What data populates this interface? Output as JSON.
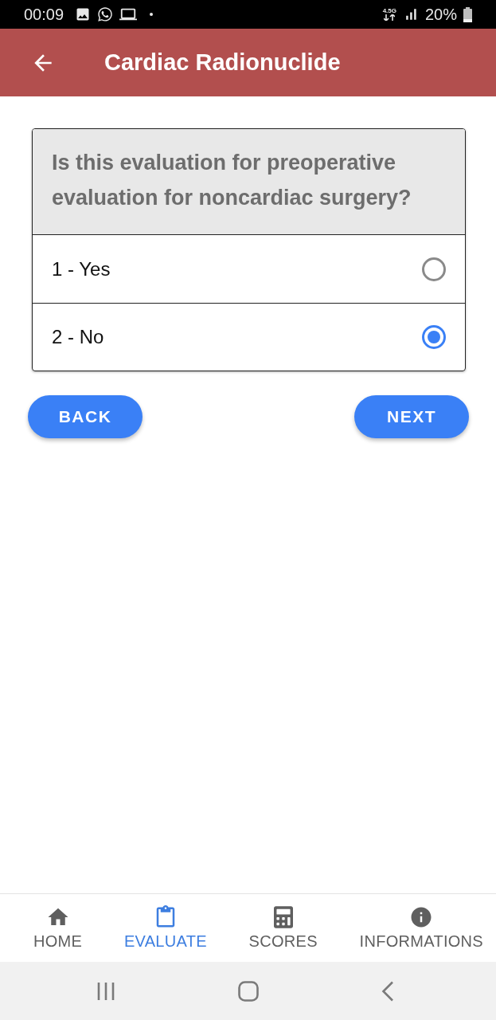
{
  "status_bar": {
    "time": "00:09",
    "network": "4.5G",
    "battery": "20%"
  },
  "app_bar": {
    "title": "Cardiac Radionuclide"
  },
  "question": {
    "text": "Is this evaluation for preoperative evaluation for noncardiac surgery?",
    "options": [
      {
        "label": "1 - Yes",
        "selected": false
      },
      {
        "label": "2 - No",
        "selected": true
      }
    ]
  },
  "buttons": [
    {
      "label": "BACK"
    },
    {
      "label": "NEXT"
    }
  ],
  "bottom_nav": [
    {
      "label": "HOME",
      "kind": "home",
      "selected": false
    },
    {
      "label": "EVALUATE",
      "kind": "evaluate",
      "selected": true
    },
    {
      "label": "SCORES",
      "kind": "scores",
      "selected": false
    },
    {
      "label": "INFORMATIONS",
      "kind": "info",
      "selected": false
    }
  ]
}
